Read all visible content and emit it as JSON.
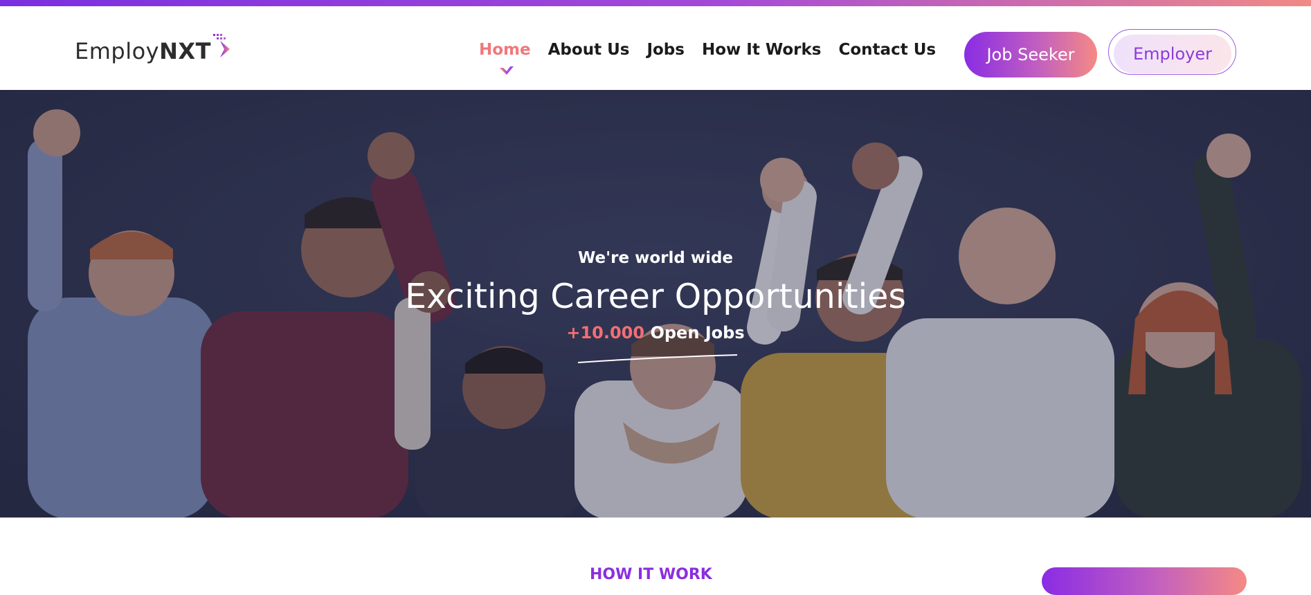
{
  "brand": {
    "name_regular": "Employ",
    "name_bold": "NXT",
    "accent_gradient": [
      "#7a2fe0",
      "#f08a86"
    ]
  },
  "nav": {
    "items": [
      {
        "label": "Home",
        "active": true
      },
      {
        "label": "About Us",
        "active": false
      },
      {
        "label": "Jobs",
        "active": false
      },
      {
        "label": "How It Works",
        "active": false
      },
      {
        "label": "Contact Us",
        "active": false
      }
    ],
    "active_color": "#f0787c"
  },
  "actions": {
    "job_seeker_label": "Job Seeker",
    "employer_label": "Employer"
  },
  "hero": {
    "kicker": "We're world wide",
    "title": "Exciting Career Opportunities",
    "count": "+10.000",
    "count_suffix": "Open Jobs"
  },
  "next_section": {
    "title": "HOW IT WORK"
  }
}
